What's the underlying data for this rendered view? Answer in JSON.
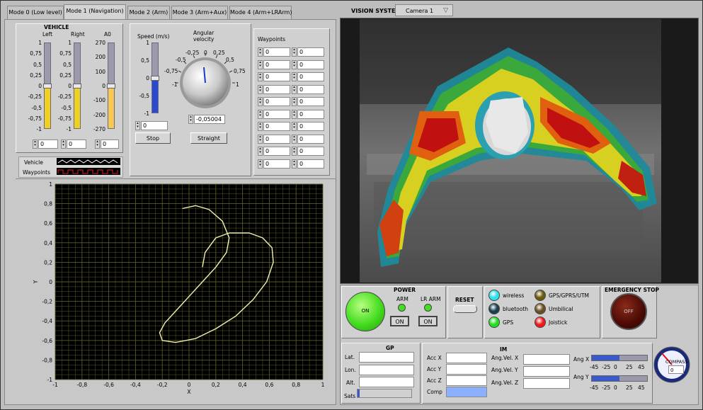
{
  "tabs": [
    {
      "label": "Mode 0 (Low level)"
    },
    {
      "label": "Mode 1 (Navigation)"
    },
    {
      "label": "Mode 2 (Arm)"
    },
    {
      "label": "Mode 3 (Arm+Aux)"
    },
    {
      "label": "Mode 4 (Arm+LRArm)"
    }
  ],
  "vision": {
    "label": "VISION SYSTEM",
    "camera": "Camera 1"
  },
  "vehicle": {
    "title": "VEHICLE",
    "left": {
      "label": "Left",
      "ticks": [
        "1",
        "0,75",
        "0,5",
        "0,25",
        "0",
        "-0,25",
        "-0,5",
        "-0,75",
        "-1"
      ],
      "value": "0",
      "level": 0.5
    },
    "right": {
      "label": "Right",
      "ticks": [
        "1",
        "0,75",
        "0,5",
        "0,25",
        "0",
        "-0,25",
        "-0,5",
        "-0,75",
        "-1"
      ],
      "value": "0",
      "level": 0.5
    },
    "a0": {
      "label": "A0",
      "ticks": [
        "270",
        "200",
        "100",
        "0",
        "-100",
        "-200",
        "-270"
      ],
      "value": "0",
      "level": 0.5
    }
  },
  "speed": {
    "label": "Speed (m/s)",
    "ticks": [
      "1",
      "0,5",
      "0",
      "-0,5",
      "-1"
    ],
    "value": "0",
    "level": 0.5,
    "stop_label": "Stop"
  },
  "angular": {
    "label1": "Angular",
    "label2": "velocity",
    "ticks": [
      "-0,25",
      "0",
      "0,25",
      "-0,5",
      "0,5",
      "-0,75",
      "0,75",
      "-1",
      "1"
    ],
    "value": "-0,05004",
    "straight_label": "Straight"
  },
  "waypoints": {
    "title": "Waypoints",
    "rows": [
      [
        "0",
        "0"
      ],
      [
        "0",
        "0"
      ],
      [
        "0",
        "0"
      ],
      [
        "0",
        "0"
      ],
      [
        "0",
        "0"
      ],
      [
        "0",
        "0"
      ],
      [
        "0",
        "0"
      ],
      [
        "0",
        "0"
      ],
      [
        "0",
        "0"
      ],
      [
        "0",
        "0"
      ]
    ]
  },
  "legend": {
    "vehicle": "Vehicle",
    "waypoints": "Waypoints"
  },
  "chart_data": {
    "type": "line",
    "xlabel": "X",
    "ylabel": "Y",
    "xlim": [
      -1,
      1
    ],
    "ylim": [
      -1,
      1
    ],
    "xticks": [
      "-1",
      "-0,8",
      "-0,6",
      "-0,4",
      "-0,2",
      "0",
      "0,2",
      "0,4",
      "0,6",
      "0,8",
      "1"
    ],
    "yticks": [
      "1",
      "0,8",
      "0,6",
      "0,4",
      "0,2",
      "0",
      "-0,2",
      "-0,4",
      "-0,6",
      "-0,8",
      "-1"
    ],
    "grid": true,
    "series": [
      {
        "x": [
          -0.05,
          0.05,
          0.15,
          0.25,
          0.3,
          0.28,
          0.2,
          0.1,
          0.0,
          -0.1,
          -0.18,
          -0.22,
          -0.2,
          -0.1,
          0.05,
          0.2,
          0.35,
          0.48,
          0.58,
          0.63,
          0.62,
          0.55,
          0.45,
          0.3,
          0.2,
          0.12,
          0.1
        ],
        "y": [
          0.75,
          0.78,
          0.74,
          0.62,
          0.45,
          0.3,
          0.15,
          0.0,
          -0.15,
          -0.3,
          -0.42,
          -0.52,
          -0.6,
          -0.62,
          -0.58,
          -0.48,
          -0.35,
          -0.18,
          0.0,
          0.2,
          0.35,
          0.45,
          0.5,
          0.5,
          0.45,
          0.3,
          0.15
        ],
        "color": "#f3f0b0"
      }
    ]
  },
  "power": {
    "title": "POWER",
    "on_label": "ON",
    "arm_label": "ARM",
    "lr_arm_label": "LR ARM",
    "arm_btn": "ON",
    "lr_btn": "ON"
  },
  "reset": {
    "label": "RESET"
  },
  "indicators": [
    {
      "label": "wireless",
      "color": "#2ee0ee"
    },
    {
      "label": "bluetooth",
      "color": "#1a4050"
    },
    {
      "label": "GPS",
      "color": "#22dd22"
    },
    {
      "label": "GPS/GPRS/UTM",
      "color": "#6a5a10"
    },
    {
      "label": "Umbilical",
      "color": "#6a5020"
    },
    {
      "label": "Joistick",
      "color": "#ee1a1a"
    }
  ],
  "emergency": {
    "title": "EMERGENCY STOP",
    "label": "OFF"
  },
  "gp": {
    "title": "GP",
    "lat": "Lat.",
    "lon": "Lon.",
    "alt": "Alt.",
    "sats": "Sats"
  },
  "im": {
    "title": "IM",
    "acc": [
      "Acc X",
      "Acc Y",
      "Acc Z"
    ],
    "comp": "Comp",
    "angvel": [
      "Ang.Vel. X",
      "Ang.Vel. Y",
      "Ang.Vel. Z"
    ],
    "ang_x": "Ang X",
    "ang_y": "Ang Y",
    "ang_ticks": [
      "-45",
      "-25",
      "0",
      "25",
      "45"
    ],
    "ang_x_level": 0.5,
    "ang_y_level": 0.5
  },
  "compass": {
    "label": "COMPASS",
    "value": "0"
  },
  "colors": {
    "panel": "#c8c8c8",
    "plot_bg": "#000000",
    "grid": "#5a5a2a",
    "trace": "#f3f0b0"
  }
}
